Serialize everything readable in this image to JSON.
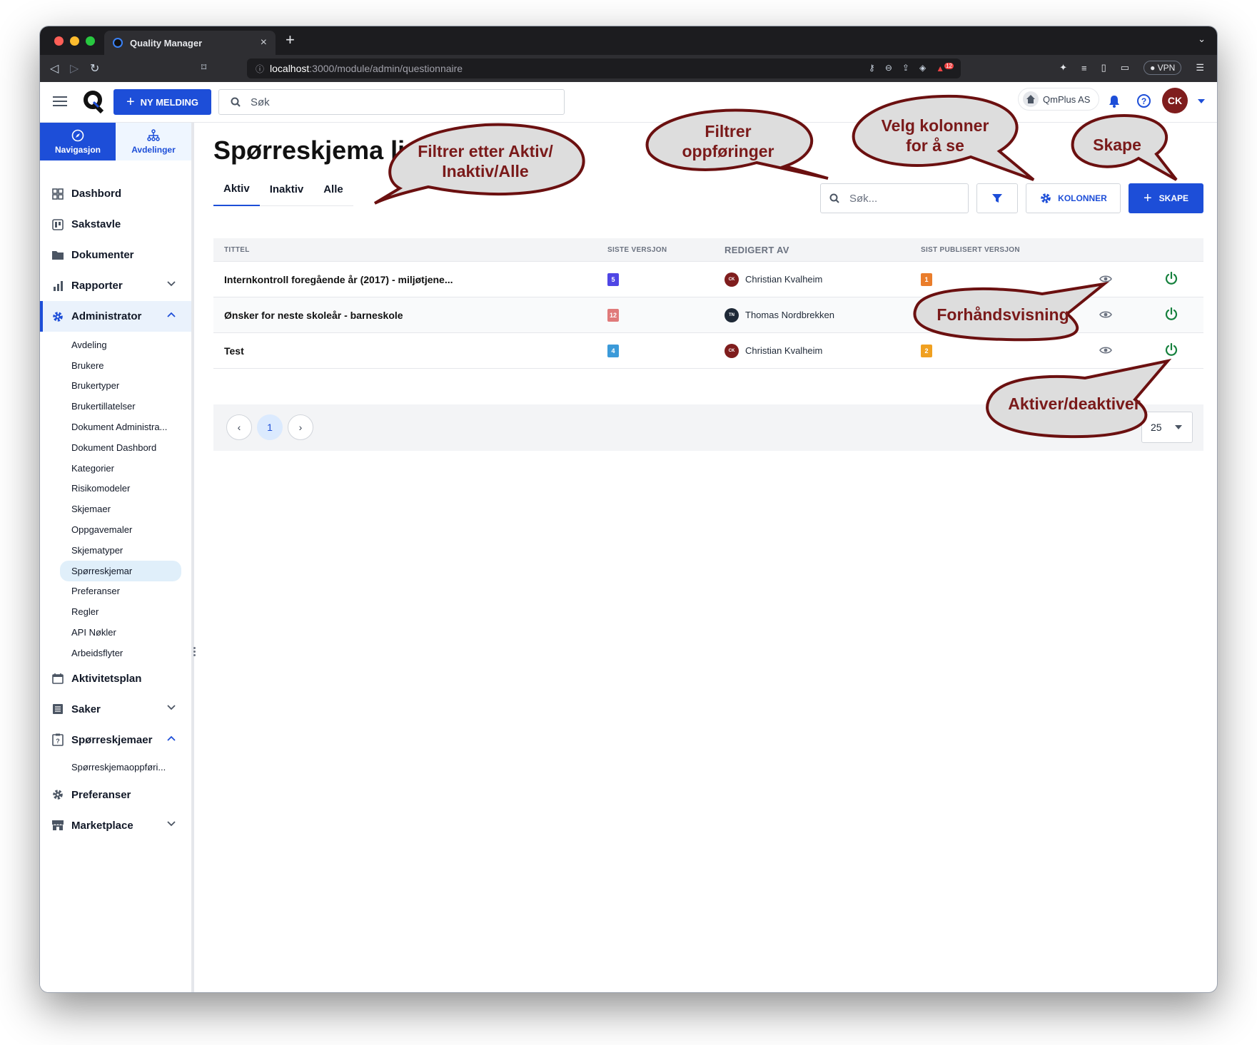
{
  "browser": {
    "tab_title": "Quality Manager",
    "url_host": "localhost",
    "url_path": ":3000/module/admin/questionnaire",
    "vpn_label": "VPN",
    "ext_badge": "12"
  },
  "header": {
    "new_button": "NY MELDING",
    "search_placeholder": "Søk",
    "org_name": "QmPlus AS",
    "avatar": "CK"
  },
  "sidebar": {
    "tabs": [
      {
        "label": "Navigasjon"
      },
      {
        "label": "Avdelinger"
      }
    ],
    "items": {
      "dashbord": "Dashbord",
      "sakstavle": "Sakstavle",
      "dokumenter": "Dokumenter",
      "rapporter": "Rapporter",
      "administrator": "Administrator",
      "admin_sub": [
        "Avdeling",
        "Brukere",
        "Brukertyper",
        "Brukertillatelser",
        "Dokument Administra...",
        "Dokument Dashbord",
        "Kategorier",
        "Risikomodeler",
        "Skjemaer",
        "Oppgavemaler",
        "Skjematyper",
        "Spørreskjemar",
        "Preferanser",
        "Regler",
        "API Nøkler",
        "Arbeidsflyter"
      ],
      "aktivitetsplan": "Aktivitetsplan",
      "saker": "Saker",
      "sporreskjemaer": "Spørreskjemaer",
      "sporre_sub": [
        "Spørreskjemaoppføri..."
      ],
      "preferanser": "Preferanser",
      "marketplace": "Marketplace"
    }
  },
  "main": {
    "title": "Spørreskjema li",
    "tabs": [
      {
        "label": "Aktiv"
      },
      {
        "label": "Inaktiv"
      },
      {
        "label": "Alle"
      }
    ],
    "search_placeholder": "Søk...",
    "columns_button": "KOLONNER",
    "create_button": "SKAPE",
    "table": {
      "headers": [
        "TITTEL",
        "SISTE VERSJON",
        "REDIGERT AV",
        "SIST PUBLISERT VERSJON"
      ],
      "rows": [
        {
          "title": "Internkontroll foregående år (2017) - miljøtjene...",
          "version": "5",
          "version_color": "#4f46e5",
          "initials": "CK",
          "editor": "Christian Kvalheim",
          "avatar_color": "#7f1d1d",
          "published": "1",
          "published_color": "#ea7d2b"
        },
        {
          "title": "Ønsker for neste skoleår - barneskole",
          "version": "12",
          "version_color": "#e07a7a",
          "initials": "TN",
          "editor": "Thomas Nordbrekken",
          "avatar_color": "#1f2937",
          "published": "",
          "published_color": ""
        },
        {
          "title": "Test",
          "version": "4",
          "version_color": "#3b9ad9",
          "initials": "CK",
          "editor": "Christian Kvalheim",
          "avatar_color": "#7f1d1d",
          "published": "2",
          "published_color": "#f0a020"
        }
      ]
    },
    "pagination": {
      "page": "1",
      "per_page": "25"
    }
  },
  "callouts": {
    "filter_tabs": [
      "Filtrer etter Aktiv/",
      "Inaktiv/Alle"
    ],
    "filter_entries": [
      "Filtrer",
      "oppføringer"
    ],
    "columns": [
      "Velg kolonner",
      "for å se"
    ],
    "create": "Skape",
    "preview": "Forhåndsvisning",
    "toggle": "Aktiver/deaktiver"
  },
  "colors": {
    "accent": "#1d4ed8",
    "callout_fill": "#dddddd",
    "callout_stroke": "#6b1010",
    "callout_text": "#7a1a1a",
    "power": "#15803d"
  }
}
